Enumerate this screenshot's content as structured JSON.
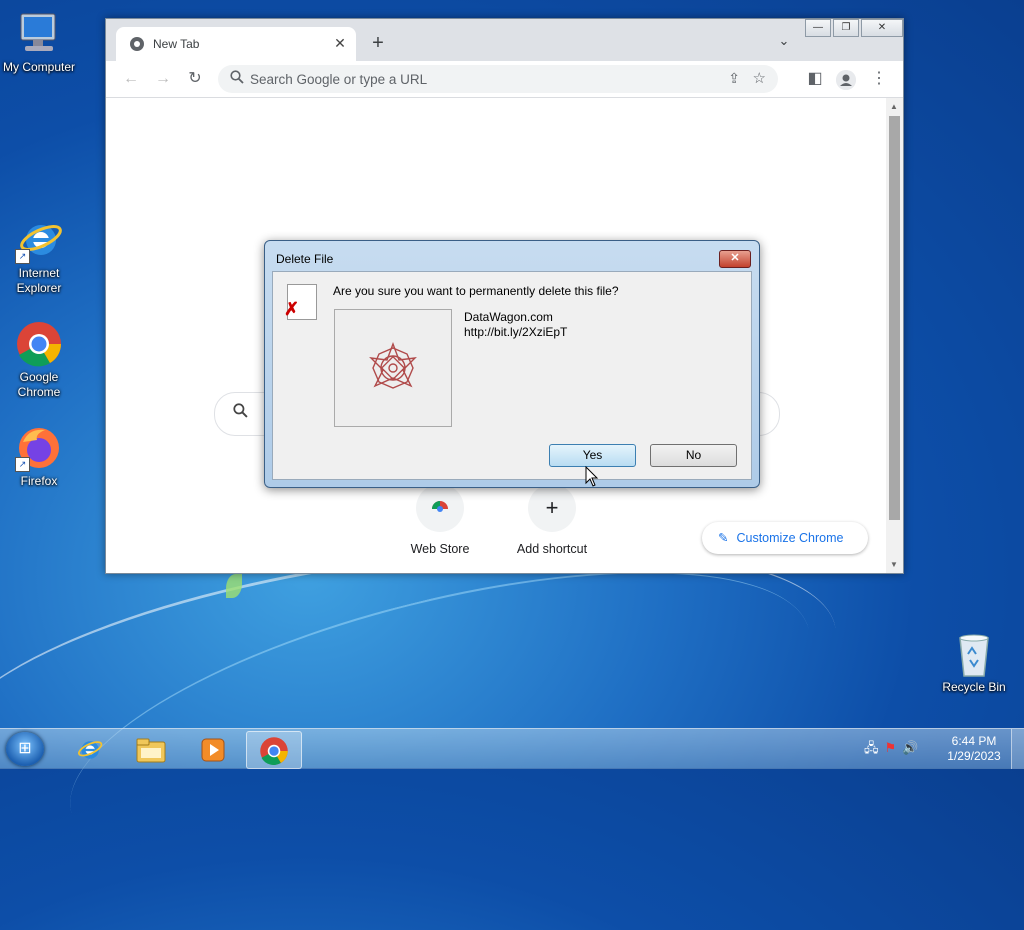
{
  "desktop": {
    "icons": [
      {
        "label": "My Computer"
      },
      {
        "label": "Internet Explorer"
      },
      {
        "label": "Google Chrome"
      },
      {
        "label": "Firefox"
      },
      {
        "label": "Recycle Bin"
      }
    ]
  },
  "browser": {
    "tab_title": "New Tab",
    "omnibox_placeholder": "Search Google or type a URL",
    "shortcuts": [
      {
        "label": "Web Store"
      },
      {
        "label": "Add shortcut"
      }
    ],
    "customize_label": "Customize Chrome"
  },
  "dialog": {
    "title": "Delete File",
    "question": "Are you sure you want to permanently delete this file?",
    "file_name": "DataWagon.com",
    "file_url": "http://bit.ly/2XziEpT",
    "yes_label": "Yes",
    "no_label": "No"
  },
  "taskbar": {
    "time": "6:44 PM",
    "date": "1/29/2023"
  }
}
